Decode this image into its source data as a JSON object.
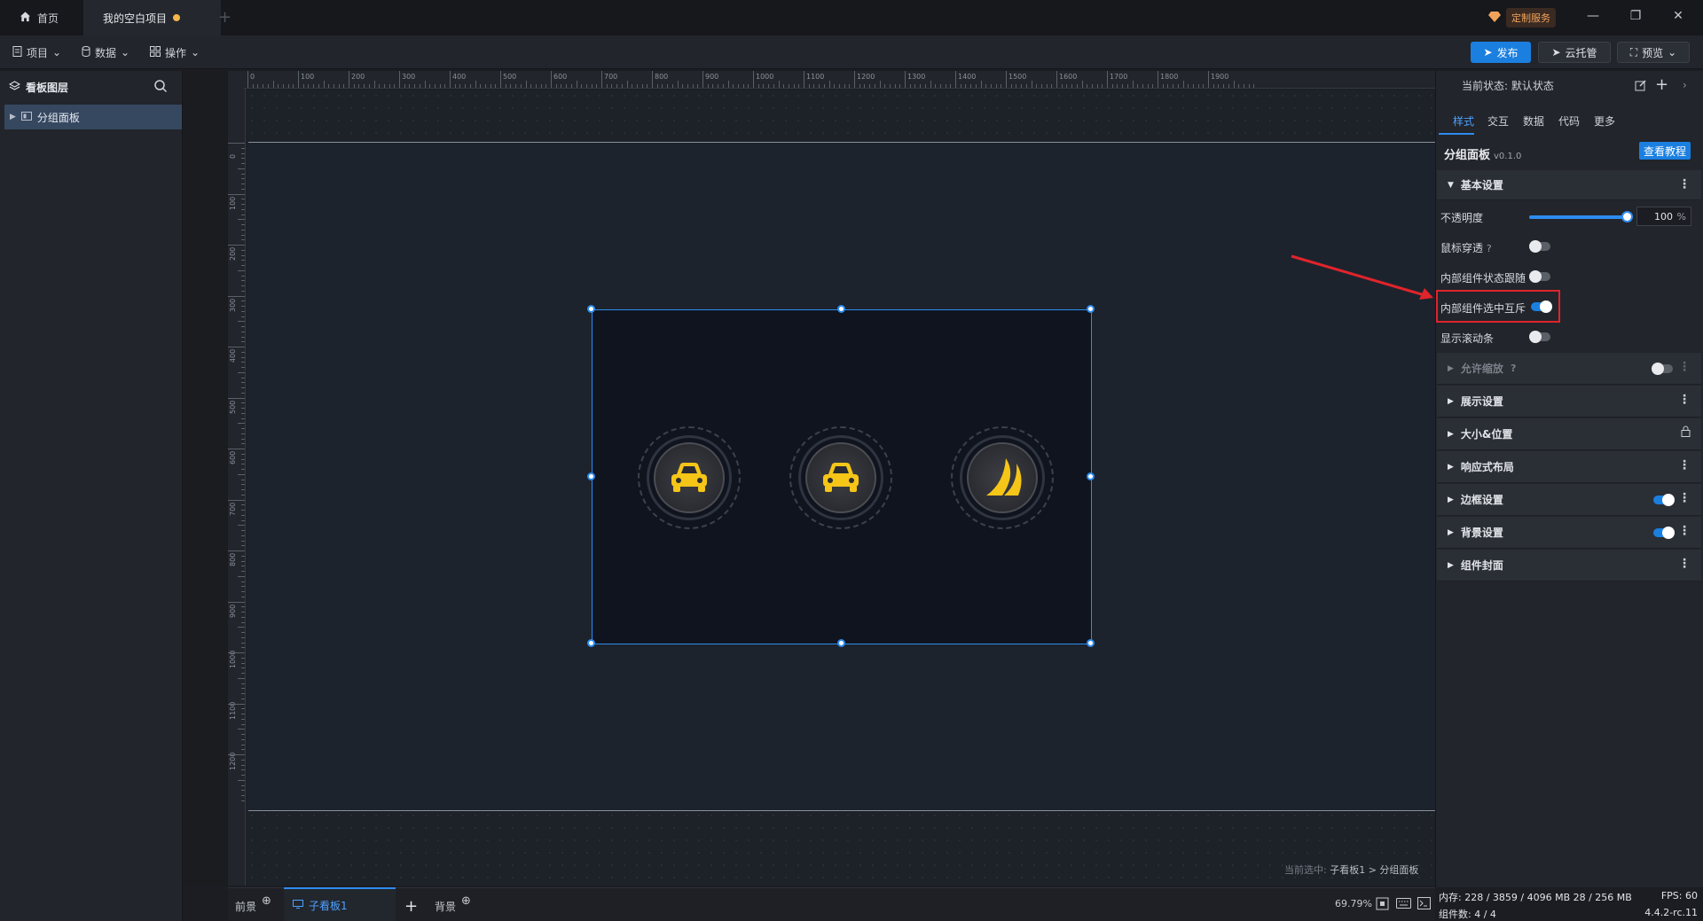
{
  "titlebar": {
    "home_tab": "首页",
    "project_tab": "我的空白项目",
    "add_tab": "+",
    "custom_service": "定制服务",
    "minimize": "—",
    "restore": "❐",
    "close": "✕"
  },
  "toolbar": {
    "menu_project": "项目",
    "menu_data": "数据",
    "menu_operate": "操作",
    "publish": "发布",
    "cloud_hosting": "云托管",
    "preview": "预览"
  },
  "left_panel": {
    "title": "看板图层",
    "layers": [
      "分组面板"
    ]
  },
  "ruler": {
    "top_ticks": [
      "0",
      "100",
      "200",
      "300",
      "400",
      "500",
      "600",
      "700",
      "800",
      "900",
      "1000",
      "1100",
      "1200",
      "1300",
      "1400",
      "1500",
      "1600",
      "1700",
      "1800",
      "1900"
    ],
    "left_ticks": [
      "0",
      "100",
      "200",
      "300",
      "400",
      "500",
      "600",
      "700",
      "800",
      "900",
      "1000",
      "1100",
      "1200"
    ]
  },
  "canvas": {
    "icons": [
      "car-icon",
      "car-icon",
      "road-icon"
    ],
    "selection_prefix": "当前选中:",
    "selection_path": "子看板1 > 分组面板"
  },
  "bottom_tabs": {
    "foreground": "前景",
    "child_board": "子看板1",
    "add": "+",
    "background": "背景",
    "zoom": "69.79%"
  },
  "right_panel": {
    "state_label": "当前状态: 默认状态",
    "tabs": [
      "样式",
      "交互",
      "数据",
      "代码",
      "更多"
    ],
    "component_title": "分组面板",
    "component_version": "v0.1.0",
    "tutorial_button": "查看教程",
    "basic_settings": {
      "title": "基本设置",
      "opacity_label": "不透明度",
      "opacity_value": "100",
      "opacity_unit": "%",
      "opacity_percent": 100,
      "mouse_through_label": "鼠标穿透",
      "mouse_through_on": false,
      "inner_state_follow_label": "内部组件状态跟随",
      "inner_state_follow_on": false,
      "inner_select_exclusive_label": "内部组件选中互斥",
      "inner_select_exclusive_on": true,
      "show_scrollbar_label": "显示滚动条",
      "show_scrollbar_on": false
    },
    "sections": [
      {
        "title": "允许缩放",
        "toggle": false,
        "dimmed": true
      },
      {
        "title": "展示设置"
      },
      {
        "title": "大小&位置",
        "locked": true
      },
      {
        "title": "响应式布局"
      },
      {
        "title": "边框设置",
        "toggle": true
      },
      {
        "title": "背景设置",
        "toggle": true
      },
      {
        "title": "组件封面"
      }
    ]
  },
  "status_bar": {
    "memory": "内存: 228 / 3859 / 4096 MB  28 / 256 MB",
    "fps": "FPS: 60",
    "component_count": "组件数: 4 / 4",
    "version": "4.4.2-rc.11"
  },
  "colors": {
    "accent": "#2d8cf0",
    "highlight": "#e0242b",
    "icon_yellow": "#f5c518"
  }
}
